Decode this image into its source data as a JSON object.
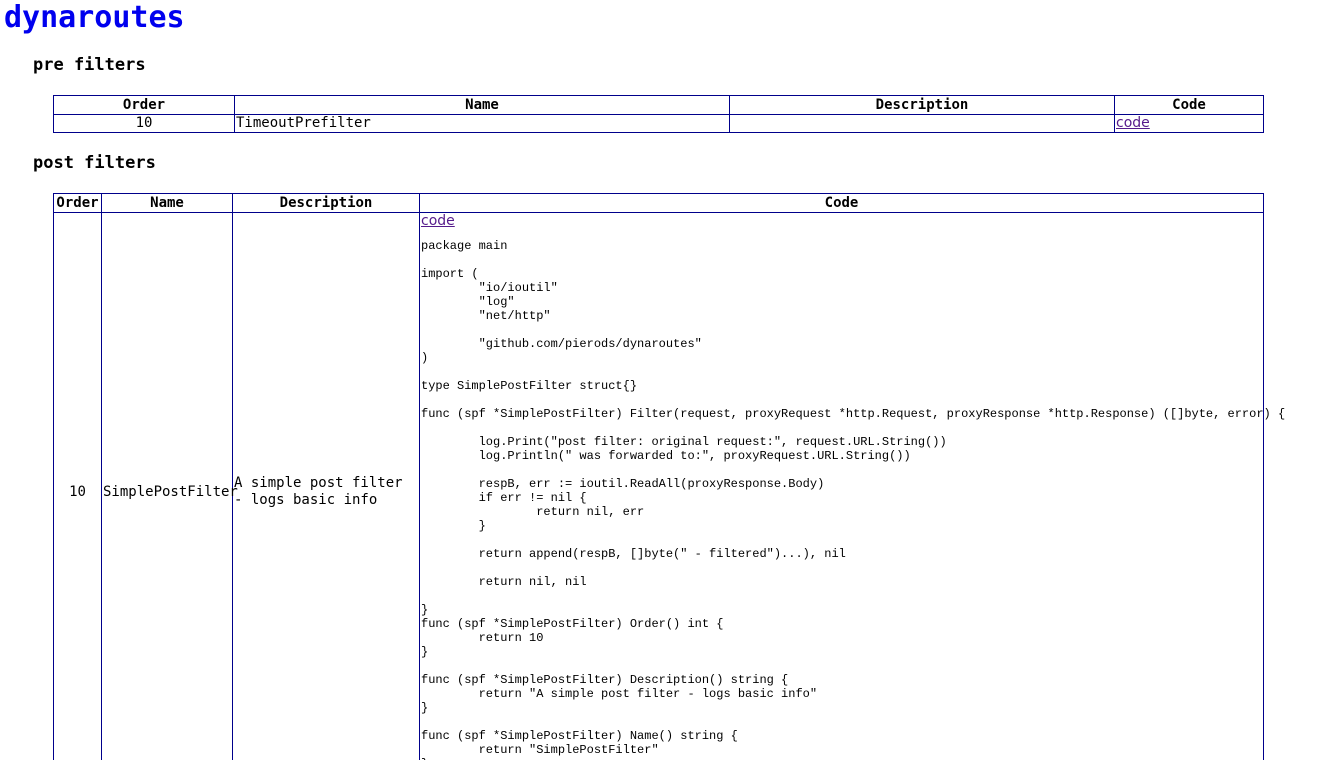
{
  "title": "dynaroutes",
  "pre_filters": {
    "heading": "pre filters",
    "columns": {
      "order": "Order",
      "name": "Name",
      "description": "Description",
      "code": "Code"
    },
    "rows": [
      {
        "order": "10",
        "name": "TimeoutPrefilter",
        "description": "",
        "code_link": "code"
      }
    ]
  },
  "post_filters": {
    "heading": "post filters",
    "columns": {
      "order": "Order",
      "name": "Name",
      "description": "Description",
      "code": "Code"
    },
    "rows": [
      {
        "order": "10",
        "name": "SimplePostFilter",
        "description": "A simple post filter - logs basic info",
        "code_link": "code",
        "source": "package main\n\nimport (\n\t\"io/ioutil\"\n\t\"log\"\n\t\"net/http\"\n\n\t\"github.com/pierods/dynaroutes\"\n)\n\ntype SimplePostFilter struct{}\n\nfunc (spf *SimplePostFilter) Filter(request, proxyRequest *http.Request, proxyResponse *http.Response) ([]byte, error) {\n\n\tlog.Print(\"post filter: original request:\", request.URL.String())\n\tlog.Println(\" was forwarded to:\", proxyRequest.URL.String())\n\n\trespB, err := ioutil.ReadAll(proxyResponse.Body)\n\tif err != nil {\n\t\treturn nil, err\n\t}\n\n\treturn append(respB, []byte(\" - filtered\")...), nil\n\n\treturn nil, nil\n\n}\nfunc (spf *SimplePostFilter) Order() int {\n\treturn 10\n}\n\nfunc (spf *SimplePostFilter) Description() string {\n\treturn \"A simple post filter - logs basic info\"\n}\n\nfunc (spf *SimplePostFilter) Name() string {\n\treturn \"SimplePostFilter\"\n}"
      }
    ]
  },
  "colors": {
    "title_link": "#0000ee",
    "visited_link": "#551a8b",
    "table_border": "#00008b"
  }
}
